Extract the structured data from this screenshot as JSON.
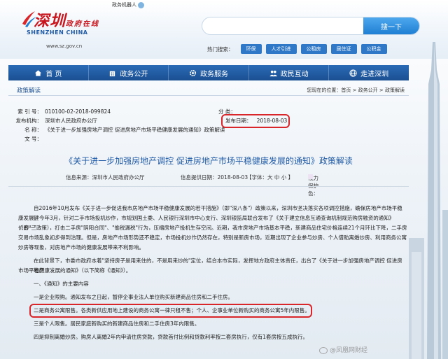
{
  "header": {
    "logo_cn": "深圳",
    "logo_cn_sub": "政府在线",
    "logo_en": "SHENZHEN CHINA",
    "logo_url": "www.sz.gov.cn",
    "robot_label": "政务机器人",
    "search_placeholder": "",
    "search_button": "搜一下",
    "hot_label": "热门搜索：",
    "hot_links": [
      "环保",
      "人才引进",
      "公租房",
      "居住证",
      "公积金"
    ]
  },
  "nav": {
    "items": [
      {
        "label": "首 页",
        "icon": "home-icon"
      },
      {
        "label": "政务公开",
        "icon": "building-icon"
      },
      {
        "label": "政务服务",
        "icon": "gear-icon"
      },
      {
        "label": "政民互动",
        "icon": "people-icon"
      },
      {
        "label": "走进深圳",
        "icon": "globe-icon"
      }
    ]
  },
  "crumb": {
    "section": "政策解读",
    "path": "您现在的位置：首页 > 政务公开 > 政策解读"
  },
  "info": {
    "index_key": "索 引 号：",
    "index_val": "010100-02-2018-099824",
    "org_key": "发布机构：",
    "org_val": "深圳市人民政府办公厅",
    "name_key": "名 称：",
    "name_val": "《关于进一步加强房地产调控 促进房地产市场平稳健康发展的通知》政策解读",
    "doc_key": "文 号：",
    "cat_key": "分 类：",
    "date_key": "发布日期：",
    "date_val": "2018-08-03"
  },
  "article": {
    "title": "《关于进一步加强房地产调控 促进房地产市场平稳健康发展的通知》政策解读",
    "source": "信息来源：深圳市人民政府办公厅",
    "provide_date": "信息提供日期：2018-08-03",
    "font_size": "【字体：大 中 小 】",
    "vision": "视力保护色：",
    "swatch_colors": [
      "#fbe6e6",
      "#fdf6d8",
      "#e6f2e2",
      "#e0ecf8",
      "#ece2f3"
    ],
    "paragraphs": [
      "自2016年10月发布《关于进一步促进我市房地产市场平稳健康发展的若干措施》（即\"深八条\"）政策以来，深圳市坚决落实各项调控措施，确保房地产市场平稳健",
      "康发展。今年3月，针对二手市场投机炒作，市规划国土委、人民银行深圳市中心支行、深圳银监局联合发布了《关于建立信息互通查询机制规范购房融资的通知》（即\"三",
      "价合一\"政策），打击二手房\"阴阳合同\"、\"偷税漏税\"行为，压缩房地产投机生存空间。近期，我市房地产市场基本平稳，新建商品住宅价格连续21个月环比下降，二手房",
      "交易市场乱象初步得到治理。但是，房地产市场形势还不稳定，市场投机炒作仍然存在，特别是新房市场，近期出现了企业参与炒房、个人借助离婚炒房、利用商务公寓",
      "炒房等现象，对房地产市场的健康发展带来不利影响。",
      "在此背景下，市委市政府本着\"坚持房子是用来住的，不是用来炒的\"定位，结合本市实际，发挥地方政府主体责任，出台了《关于进一步加强房地产调控 促进房地产",
      "市场平稳健康发展的通知》（以下简称《通知》）。",
      "一、《通知》的主要内容",
      "一是企业限购。通知发布之日起，暂停企事业法人单位购买新建商品住房和二手住房。",
      "二是商务公寓限售。各类新供应用地上建设的商务公寓一律只租不售；个人、企事业单位新购买的商务公寓5年内限售。",
      "三是个人限售。居民家庭新购买的新建商品住房和二手住房3年内限售。",
      "四是抑制离婚炒房。购房人离婚2年内申请住房贷款，贷款首付比例和贷款利率按二套房执行，仅有1套房按五成执行。"
    ]
  },
  "watermark": "@凤凰网财经"
}
